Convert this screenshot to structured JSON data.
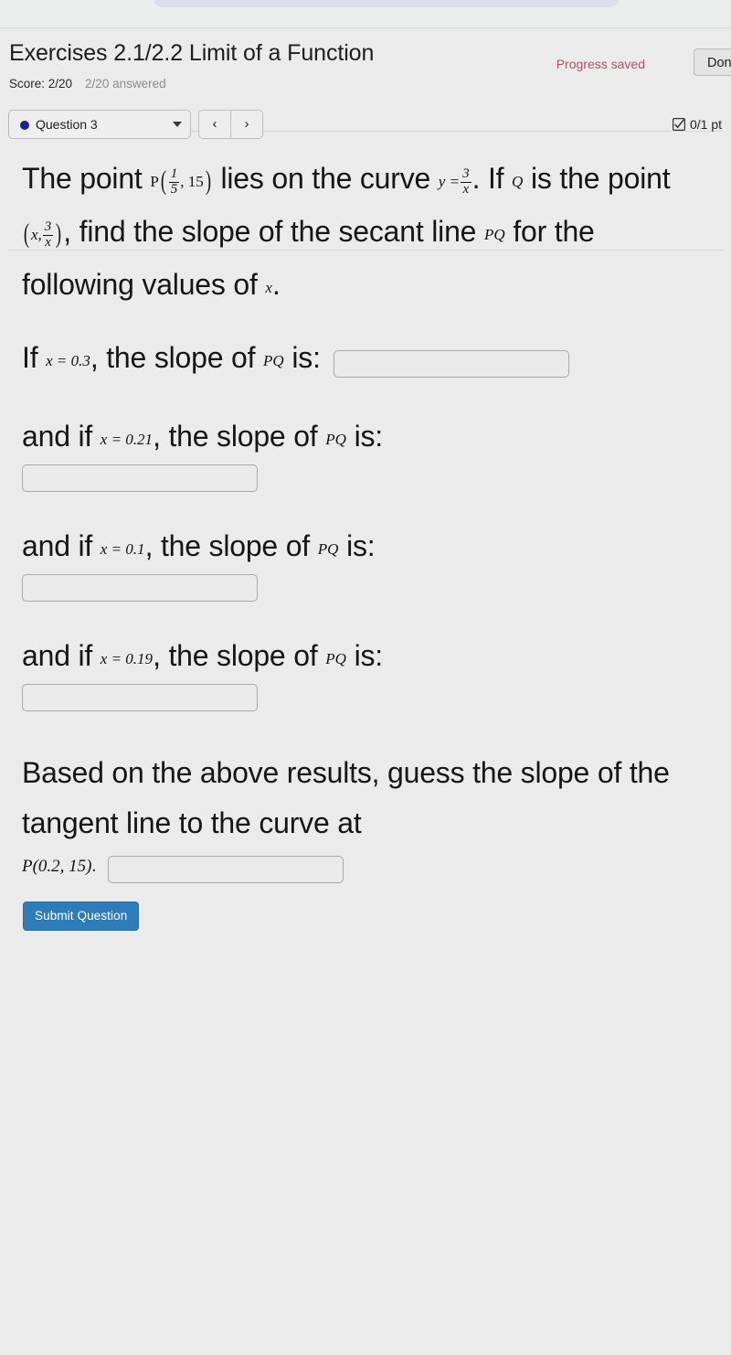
{
  "window": {
    "top_strip": ""
  },
  "header": {
    "title": "Exercises 2.1/2.2 Limit of a Function",
    "score_label": "Score: 2/20",
    "answered_label": "2/20 answered",
    "progress_saved": "Progress saved",
    "done_button": "Done",
    "progress_saved_color": "#b0545f"
  },
  "navbar": {
    "question_select": "Question 3",
    "question_dot_color": "#1d1f8f",
    "prev_label": "‹",
    "next_label": "›",
    "points_label": "0/1 pt",
    "points_icon": "checkbox-checked-icon"
  },
  "question": {
    "stem": {
      "t1": "The point ",
      "point_P_symbol": "P",
      "point_P_x_num": "1",
      "point_P_x_den": "5",
      "point_P_y": "15",
      "t2": " lies on the curve ",
      "curve_lhs": "y =",
      "curve_num": "3",
      "curve_den": "x",
      "t3": ". If ",
      "point_Q_symbol": "Q",
      "t4": " is the point ",
      "Q_x": "x,",
      "Q_y_num": "3",
      "Q_y_den": "x",
      "t5": ", find the slope of the secant line ",
      "secant_PQ": "PQ",
      "t6": " for the following values of ",
      "var_x": "x",
      "t7": "."
    },
    "parts": [
      {
        "prefix": "If ",
        "condition": "x = 0.3",
        "middle": ", the slope of ",
        "secant": "PQ",
        "suffix": " is:",
        "input_value": "",
        "input_placeholder": "",
        "inline_input": true
      },
      {
        "prefix": "and if ",
        "condition": "x = 0.21",
        "middle": ", the slope of ",
        "secant": "PQ",
        "suffix": " is:",
        "input_value": "",
        "input_placeholder": "",
        "inline_input": false
      },
      {
        "prefix": "and if ",
        "condition": "x = 0.1",
        "middle": ", the slope of ",
        "secant": "PQ",
        "suffix": " is:",
        "input_value": "",
        "input_placeholder": "",
        "inline_input": false
      },
      {
        "prefix": "and if ",
        "condition": "x = 0.19",
        "middle": ", the slope of ",
        "secant": "PQ",
        "suffix": " is:",
        "input_value": "",
        "input_placeholder": "",
        "inline_input": false
      }
    ],
    "final": {
      "text": "Based on the above results, guess the slope of the tangent line to the curve at",
      "point_label": "P(0.2, 15)",
      "point_period": ".",
      "input_value": "",
      "input_placeholder": ""
    },
    "submit_label": "Submit Question",
    "submit_color": "#2e7cba"
  }
}
